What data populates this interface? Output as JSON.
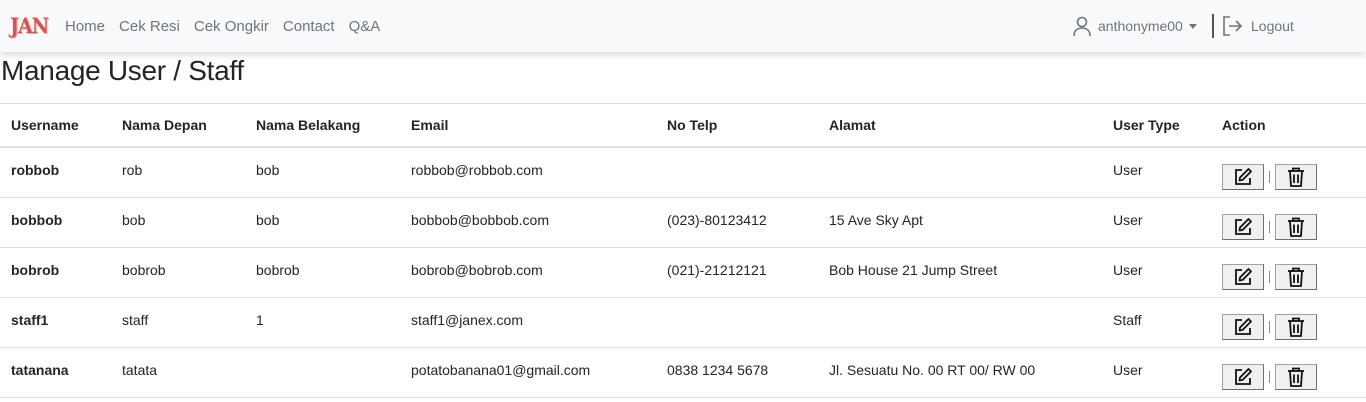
{
  "navbar": {
    "brand": "JAN",
    "links": [
      "Home",
      "Cek Resi",
      "Cek Ongkir",
      "Contact",
      "Q&A"
    ],
    "username": "anthonyme00",
    "logout_label": "Logout"
  },
  "page": {
    "title": "Manage User / Staff"
  },
  "table": {
    "headers": [
      "Username",
      "Nama Depan",
      "Nama Belakang",
      "Email",
      "No Telp",
      "Alamat",
      "User Type",
      "Action"
    ],
    "rows": [
      {
        "username": "robbob",
        "first": "rob",
        "last": "bob",
        "email": "robbob@robbob.com",
        "phone": "",
        "address": "",
        "type": "User"
      },
      {
        "username": "bobbob",
        "first": "bob",
        "last": "bob",
        "email": "bobbob@bobbob.com",
        "phone": "(023)-80123412",
        "address": "15 Ave Sky Apt",
        "type": "User"
      },
      {
        "username": "bobrob",
        "first": "bobrob",
        "last": "bobrob",
        "email": "bobrob@bobrob.com",
        "phone": "(021)-21212121",
        "address": "Bob House 21 Jump Street",
        "type": "User"
      },
      {
        "username": "staff1",
        "first": "staff",
        "last": "1",
        "email": "staff1@janex.com",
        "phone": "",
        "address": "",
        "type": "Staff"
      },
      {
        "username": "tatanana",
        "first": "tatata",
        "last": "",
        "email": "potatobanana01@gmail.com",
        "phone": "0838 1234 5678",
        "address": "Jl. Sesuatu No. 00 RT 00/ RW 00",
        "type": "User"
      }
    ]
  },
  "icons": {
    "user": "person-icon",
    "logout": "logout-icon",
    "edit": "edit-icon",
    "delete": "trash-icon"
  }
}
